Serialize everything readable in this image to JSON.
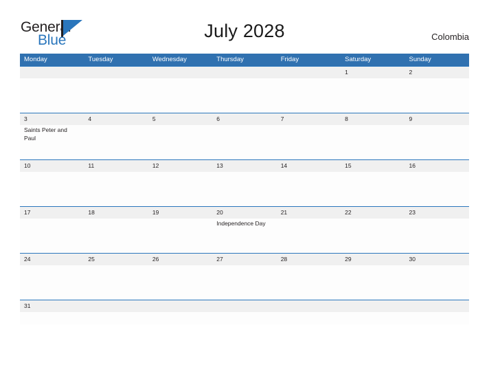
{
  "brand": {
    "name_part1": "General",
    "name_part2": "Blue",
    "flag_icon": "flag-triangle-icon",
    "accent_color": "#2a76bc"
  },
  "header": {
    "title": "July 2028",
    "country": "Colombia"
  },
  "calendar": {
    "header_bg_color": "#3071b0",
    "row_line_color": "#2a76bc",
    "daynum_band_color": "#f0f0f0",
    "day_names": [
      "Monday",
      "Tuesday",
      "Wednesday",
      "Thursday",
      "Friday",
      "Saturday",
      "Sunday"
    ],
    "weeks": [
      {
        "short": false,
        "days": [
          {
            "num": "",
            "events": []
          },
          {
            "num": "",
            "events": []
          },
          {
            "num": "",
            "events": []
          },
          {
            "num": "",
            "events": []
          },
          {
            "num": "",
            "events": []
          },
          {
            "num": "1",
            "events": []
          },
          {
            "num": "2",
            "events": []
          }
        ]
      },
      {
        "short": false,
        "days": [
          {
            "num": "3",
            "events": [
              "Saints Peter and Paul"
            ]
          },
          {
            "num": "4",
            "events": []
          },
          {
            "num": "5",
            "events": []
          },
          {
            "num": "6",
            "events": []
          },
          {
            "num": "7",
            "events": []
          },
          {
            "num": "8",
            "events": []
          },
          {
            "num": "9",
            "events": []
          }
        ]
      },
      {
        "short": false,
        "days": [
          {
            "num": "10",
            "events": []
          },
          {
            "num": "11",
            "events": []
          },
          {
            "num": "12",
            "events": []
          },
          {
            "num": "13",
            "events": []
          },
          {
            "num": "14",
            "events": []
          },
          {
            "num": "15",
            "events": []
          },
          {
            "num": "16",
            "events": []
          }
        ]
      },
      {
        "short": false,
        "days": [
          {
            "num": "17",
            "events": []
          },
          {
            "num": "18",
            "events": []
          },
          {
            "num": "19",
            "events": []
          },
          {
            "num": "20",
            "events": [
              "Independence Day"
            ]
          },
          {
            "num": "21",
            "events": []
          },
          {
            "num": "22",
            "events": []
          },
          {
            "num": "23",
            "events": []
          }
        ]
      },
      {
        "short": false,
        "days": [
          {
            "num": "24",
            "events": []
          },
          {
            "num": "25",
            "events": []
          },
          {
            "num": "26",
            "events": []
          },
          {
            "num": "27",
            "events": []
          },
          {
            "num": "28",
            "events": []
          },
          {
            "num": "29",
            "events": []
          },
          {
            "num": "30",
            "events": []
          }
        ]
      },
      {
        "short": true,
        "days": [
          {
            "num": "31",
            "events": []
          },
          {
            "num": "",
            "events": []
          },
          {
            "num": "",
            "events": []
          },
          {
            "num": "",
            "events": []
          },
          {
            "num": "",
            "events": []
          },
          {
            "num": "",
            "events": []
          },
          {
            "num": "",
            "events": []
          }
        ]
      }
    ]
  }
}
